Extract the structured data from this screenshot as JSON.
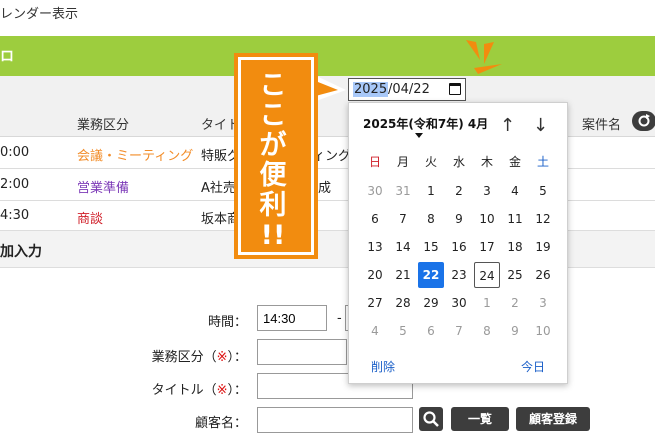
{
  "header": {
    "page_label": "レンダー表示",
    "green_title": "ロ"
  },
  "list": {
    "columns": {
      "category": "業務区分",
      "title": "タイト",
      "customer": "案件名"
    },
    "rows": [
      {
        "time": "0:00",
        "category": "会議・ミーティング",
        "category_color": "#f28c28",
        "title": "特販グ",
        "extra": "ィング"
      },
      {
        "time": "2:00",
        "category": "営業準備",
        "category_color": "#7d3bb8",
        "title": "A社売",
        "extra": "成"
      },
      {
        "time": "4:30",
        "category": "商談",
        "category_color": "#d0202a",
        "title": "坂本商",
        "extra": ""
      }
    ]
  },
  "form": {
    "section_title": "加入力",
    "time_label": "時間：",
    "time_value": "14:30",
    "time_sep": "-",
    "category_label": "業務区分（",
    "title_label": "タイトル（",
    "required_mark": "※",
    "label_close": "）：",
    "customer_label": "顧客名：",
    "list_button": "一覧",
    "register_button": "顧客登録"
  },
  "date_input": {
    "year_selected": "2025",
    "rest": "/04/22"
  },
  "callout": {
    "lines": [
      "こ",
      "こ",
      "が",
      "便",
      "利",
      "!!"
    ]
  },
  "datepicker": {
    "month_label": "2025年(令和7年) 4月",
    "up_arrow": "↑",
    "down_arrow": "↓",
    "weekdays": [
      "日",
      "月",
      "火",
      "水",
      "木",
      "金",
      "土"
    ],
    "weekday_colors": [
      "#d0202a",
      "#222222",
      "#222222",
      "#222222",
      "#222222",
      "#222222",
      "#1a5fc8"
    ],
    "weeks": [
      [
        "30",
        "31",
        "1",
        "2",
        "3",
        "4",
        "5"
      ],
      [
        "6",
        "7",
        "8",
        "9",
        "10",
        "11",
        "12"
      ],
      [
        "13",
        "14",
        "15",
        "16",
        "17",
        "18",
        "19"
      ],
      [
        "20",
        "21",
        "22",
        "23",
        "24",
        "25",
        "26"
      ],
      [
        "27",
        "28",
        "29",
        "30",
        "1",
        "2",
        "3"
      ],
      [
        "4",
        "5",
        "6",
        "7",
        "8",
        "9",
        "10"
      ]
    ],
    "other_month": [
      [
        true,
        true,
        false,
        false,
        false,
        false,
        false
      ],
      [
        false,
        false,
        false,
        false,
        false,
        false,
        false
      ],
      [
        false,
        false,
        false,
        false,
        false,
        false,
        false
      ],
      [
        false,
        false,
        false,
        false,
        false,
        false,
        false
      ],
      [
        false,
        false,
        false,
        false,
        true,
        true,
        true
      ],
      [
        true,
        true,
        true,
        true,
        true,
        true,
        true
      ]
    ],
    "selected": "22",
    "today": "24",
    "clear_label": "削除",
    "today_label": "今日"
  }
}
